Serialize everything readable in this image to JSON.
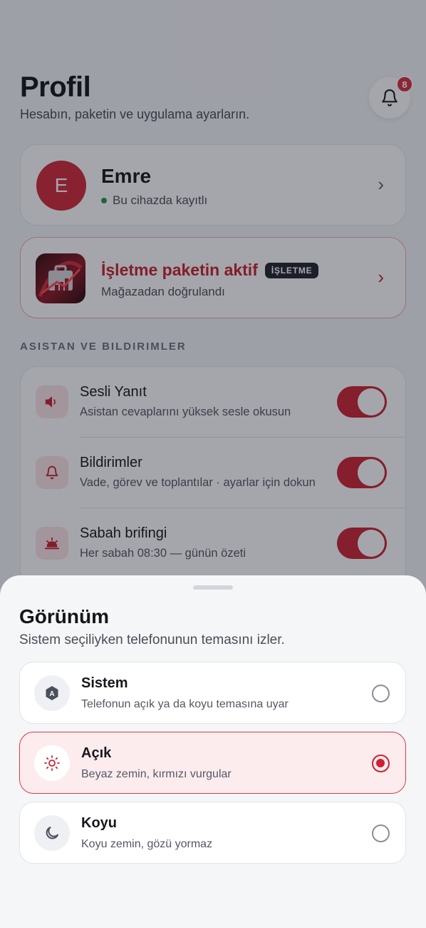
{
  "header": {
    "title": "Profil",
    "subtitle": "Hesabın, paketin ve uygulama ayarların.",
    "notification_count": "8"
  },
  "profile": {
    "avatar_initial": "E",
    "name": "Emre",
    "status": "Bu cihazda kayıtlı"
  },
  "package": {
    "title": "İşletme paketin aktif",
    "badge": "İŞLETME",
    "subtitle": "Mağazadan doğrulandı"
  },
  "section": {
    "label": "ASISTAN VE BILDIRIMLER"
  },
  "settings": [
    {
      "title": "Sesli Yanıt",
      "subtitle": "Asistan cevaplarını yüksek sesle okusun",
      "icon": "speaker-icon",
      "enabled": true
    },
    {
      "title": "Bildirimler",
      "subtitle": "Vade, görev ve toplantılar · ayarlar için dokun",
      "icon": "bell-icon",
      "enabled": true
    },
    {
      "title": "Sabah brifingi",
      "subtitle": "Her sabah 08:30 — günün özeti",
      "icon": "sunrise-icon",
      "enabled": true
    }
  ],
  "sheet": {
    "title": "Görünüm",
    "subtitle": "Sistem seçiliyken telefonunun temasını izler.",
    "options": [
      {
        "title": "Sistem",
        "subtitle": "Telefonun açık ya da koyu temasına uyar",
        "icon": "system-theme-icon",
        "selected": false
      },
      {
        "title": "Açık",
        "subtitle": "Beyaz zemin, kırmızı vurgular",
        "icon": "sun-icon",
        "selected": true
      },
      {
        "title": "Koyu",
        "subtitle": "Koyu zemin, gözü yormaz",
        "icon": "moon-icon",
        "selected": false
      }
    ]
  },
  "colors": {
    "accent": "#cc2535",
    "selected_bg": "#fdecee",
    "online": "#1f9b4e"
  }
}
